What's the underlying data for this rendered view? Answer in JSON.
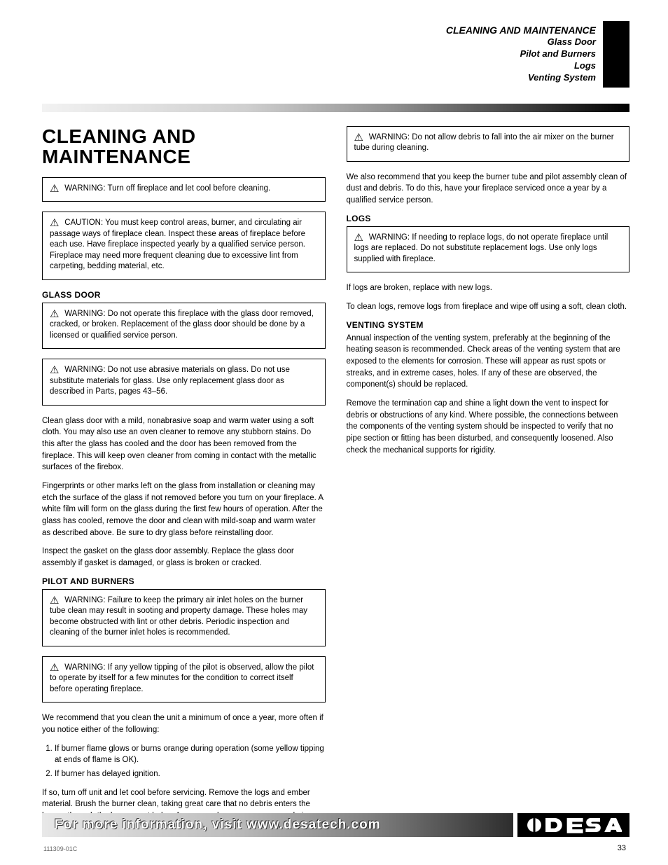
{
  "header": {
    "main": "CLEANING AND MAINTENANCE",
    "lines": [
      "Glass Door",
      "Pilot and Burners",
      "Logs",
      "Venting System"
    ]
  },
  "title": "CLEANING AND MAINTENANCE",
  "left": {
    "box1": "WARNING: Turn off fireplace and let cool before cleaning.",
    "box2": "CAUTION: You must keep control areas, burner, and circulating air passage ways of fireplace clean. Inspect these areas of fireplace before each use. Have fireplace inspected yearly by a qualified service person. Fireplace may need more frequent cleaning due to excessive lint from carpeting, bedding material, etc.",
    "glass_head": "GLASS DOOR",
    "box3": "WARNING: Do not operate this fireplace with the glass door removed, cracked, or broken. Replacement of the glass door should be done by a licensed or qualified service person.",
    "box4": "WARNING: Do not use abrasive materials on glass. Do not use substitute materials for glass. Use only replacement glass door as described in Parts, pages 43–56.",
    "glass_p1": "Clean glass door with a mild, nonabrasive soap and warm water using a soft cloth. You may also use an oven cleaner to remove any stubborn stains. Do this after the glass has cooled and the door has been removed from the fireplace. This will keep oven cleaner from coming in contact with the metallic surfaces of the firebox.",
    "glass_p2": "Fingerprints or other marks left on the glass from installation or cleaning may etch the surface of the glass if not removed before you turn on your fireplace. A white film will form on the glass during the first few hours of operation. After the glass has cooled, remove the door and clean with mild-soap and warm water as described above. Be sure to dry glass before reinstalling door.",
    "glass_p3": "Inspect the gasket on the glass door assembly. Replace the glass door assembly if gasket is damaged, or glass is broken or cracked.",
    "pilot_head": "PILOT AND BURNERS",
    "box5": "WARNING: Failure to keep the primary air inlet holes on the burner tube clean may result in sooting and property damage. These holes may become obstructed with lint or other debris. Periodic inspection and cleaning of the burner inlet holes is recommended.",
    "box6": "WARNING: If any yellow tipping of the pilot is observed, allow the pilot to operate by itself for a few minutes for the condition to correct itself before operating fireplace.",
    "pilot_p1": "We recommend that you clean the unit a minimum of once a year, more often if you notice either of the following:",
    "pilot_list": [
      "If burner flame glows or burns orange during operation (some yellow tipping at ends of flame is OK).",
      "If burner has delayed ignition."
    ],
    "pilot_p2": "If so, turn off unit and let cool before servicing. Remove the logs and ember material. Brush the burner clean, taking great care that no debris enters the burner through the burner port holes. A vacuum cleaner or compressed air may be used if care is taken. Reinstall ember material and logs."
  },
  "right": {
    "box1": "WARNING: Do not allow debris to fall into the air mixer on the burner tube during cleaning.",
    "cleaner_p": "We also recommend that you keep the burner tube and pilot assembly clean of dust and debris. To do this, have your fireplace serviced once a year by a qualified service person.",
    "logs_head": "LOGS",
    "box2": "WARNING: If needing to replace logs, do not operate fireplace until logs are replaced. Do not substitute replacement logs. Use only logs supplied with fireplace.",
    "logs_p1": "If logs are broken, replace with new logs.",
    "logs_p2": "To clean logs, remove logs from fireplace and wipe off using a soft, clean cloth.",
    "vent_head": "VENTING SYSTEM",
    "vent_p1": "Annual inspection of the venting system, preferably at the beginning of the heating season is recommended. Check areas of the venting system that are exposed to the elements for corrosion. These will appear as rust spots or streaks, and in extreme cases, holes. If any of these are observed, the component(s) should be replaced.",
    "vent_p2": "Remove the termination cap and shine a light down the vent to inspect for debris or obstructions of any kind. Where possible, the connections between the components of the venting system should be inspected to verify that no pipe section or fitting has been disturbed, and consequently loosened. Also check the mechanical supports for rigidity."
  },
  "footer": {
    "text": "For more information, visit www.desatech.com",
    "page_id": "111309-01C",
    "page_num": "33"
  }
}
